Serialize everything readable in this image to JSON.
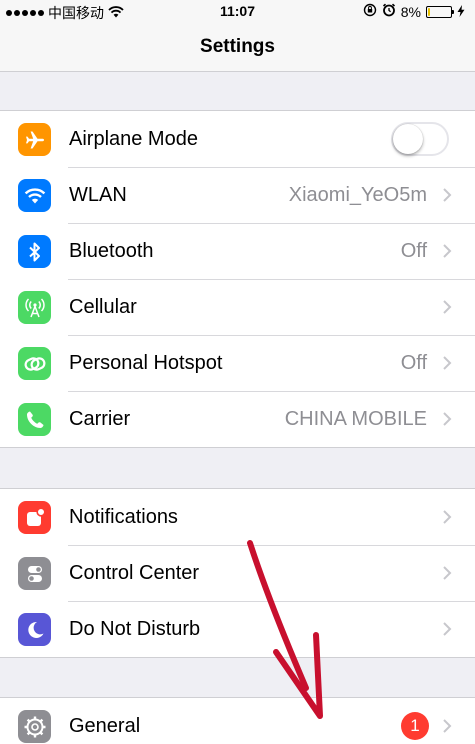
{
  "status_bar": {
    "carrier": "中国移动",
    "time": "11:07",
    "battery": "8%",
    "battery_level": 0.08,
    "icons": [
      "signal-dots-icon",
      "wifi-icon",
      "rotation-lock-icon",
      "alarm-icon",
      "battery-icon",
      "charging-bolt-icon"
    ]
  },
  "nav": {
    "title": "Settings"
  },
  "groups": [
    {
      "rows": [
        {
          "label": "Airplane Mode",
          "icon": "airplane-icon",
          "icon_bg": "#ff9500",
          "control": "toggle",
          "toggle_on": false
        },
        {
          "label": "WLAN",
          "icon": "wifi-icon",
          "icon_bg": "#007aff",
          "value": "Xiaomi_YeO5m"
        },
        {
          "label": "Bluetooth",
          "icon": "bluetooth-icon",
          "icon_bg": "#007aff",
          "value": "Off"
        },
        {
          "label": "Cellular",
          "icon": "antenna-icon",
          "icon_bg": "#4cd964",
          "value": ""
        },
        {
          "label": "Personal Hotspot",
          "icon": "link-icon",
          "icon_bg": "#4cd964",
          "value": "Off"
        },
        {
          "label": "Carrier",
          "icon": "phone-icon",
          "icon_bg": "#4cd964",
          "value": "CHINA MOBILE"
        }
      ]
    },
    {
      "rows": [
        {
          "label": "Notifications",
          "icon": "notifications-icon",
          "icon_bg": "#ff3b30",
          "value": ""
        },
        {
          "label": "Control Center",
          "icon": "switches-icon",
          "icon_bg": "#8e8e93",
          "value": ""
        },
        {
          "label": "Do Not Disturb",
          "icon": "moon-icon",
          "icon_bg": "#5856d6",
          "value": ""
        }
      ]
    },
    {
      "rows": [
        {
          "label": "General",
          "icon": "gear-icon",
          "icon_bg": "#8e8e93",
          "badge": "1"
        }
      ]
    }
  ],
  "annotation": {
    "arrow_color": "#c8102e"
  }
}
